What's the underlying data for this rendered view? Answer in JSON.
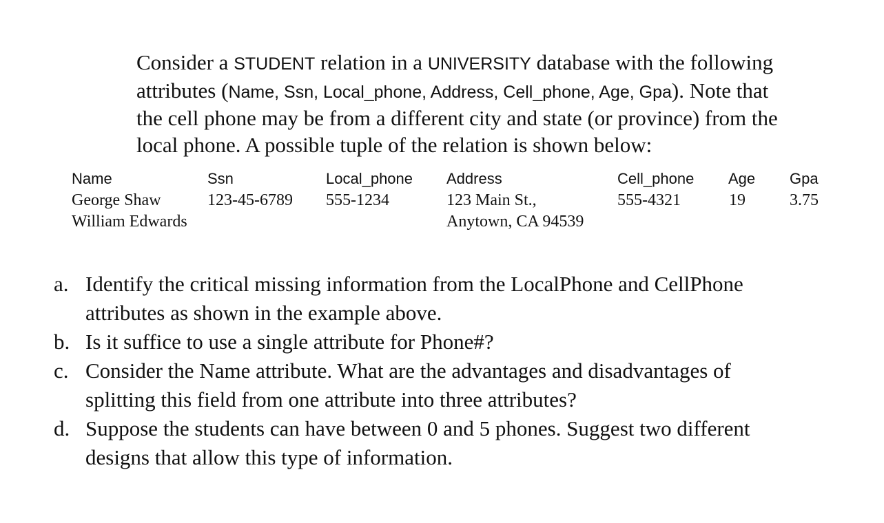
{
  "intro": {
    "lines": [
      {
        "parts": [
          "Consider a ",
          "STUDENT",
          " relation in a ",
          "UNIVERSITY",
          " database with the following"
        ]
      },
      {
        "parts": [
          "attributes (",
          "Name, Ssn, Local_phone, Address, Cell_phone, Age, Gpa",
          "). Note that"
        ]
      },
      {
        "parts": [
          "the cell phone may be from a different city and state (or province) from the"
        ]
      },
      {
        "parts": [
          "local phone. A possible tuple of the relation is shown below:"
        ]
      }
    ]
  },
  "tuple_table": {
    "headers": [
      "Name",
      "Ssn",
      "Local_phone",
      "Address",
      "Cell_phone",
      "Age",
      "Gpa"
    ],
    "rows": [
      [
        "George Shaw",
        "123-45-6789",
        "555-1234",
        "123 Main St.,",
        "555-4321",
        "19",
        "3.75"
      ],
      [
        "William Edwards",
        "",
        "",
        "Anytown, CA 94539",
        "",
        "",
        ""
      ]
    ]
  },
  "questions": [
    {
      "letter": "a.",
      "lines": [
        "Identify the critical missing information from the LocalPhone and CellPhone",
        "attributes as shown in the example above."
      ]
    },
    {
      "letter": "b.",
      "lines": [
        "Is it suffice to use a single attribute for Phone#?"
      ]
    },
    {
      "letter": "c.",
      "lines": [
        "Consider the Name attribute. What are the advantages and disadvantages of",
        "splitting this field from one attribute into three attributes?"
      ]
    },
    {
      "letter": "d.",
      "lines": [
        "Suppose the students can have between 0 and 5 phones. Suggest two different",
        "designs that allow this type of information."
      ]
    }
  ]
}
